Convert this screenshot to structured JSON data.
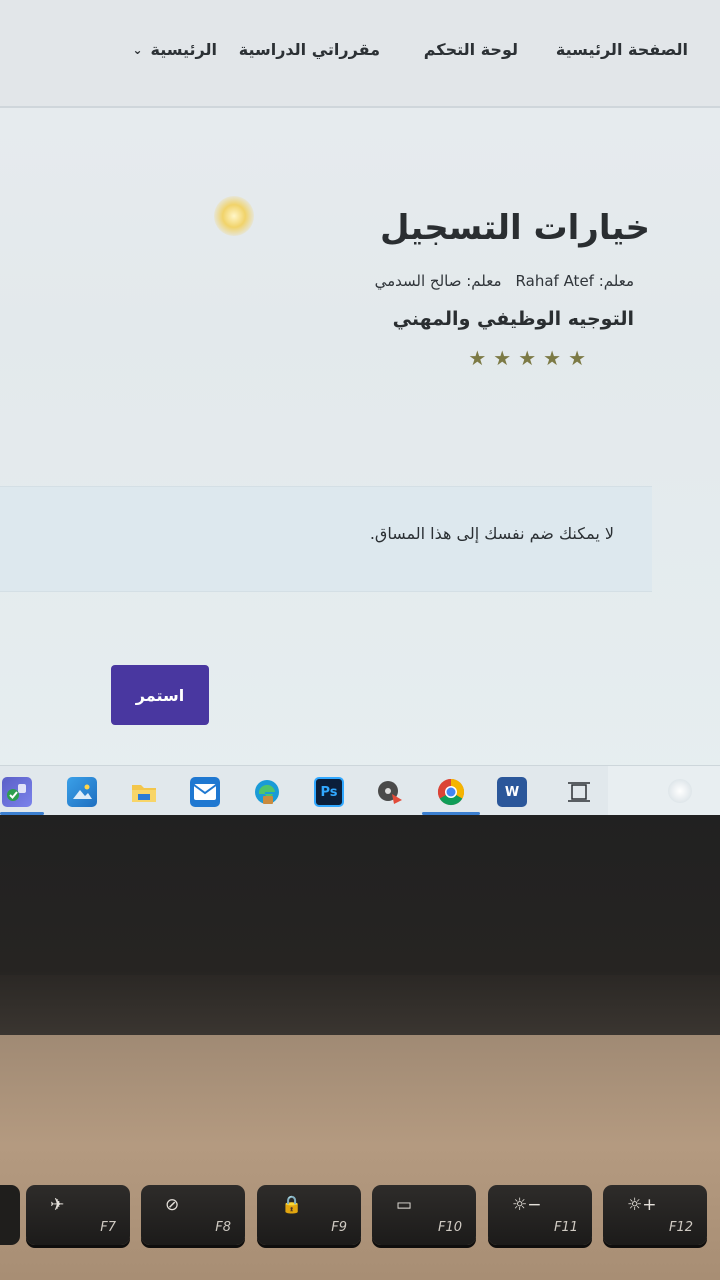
{
  "nav": {
    "home": "الصفحة الرئيسية",
    "dashboard": "لوحة التحكم",
    "my_courses": "مقرراتي الدراسية",
    "main": "الرئيسية",
    "main_chevron": "⌄"
  },
  "page": {
    "title": "خيارات التسجيل",
    "teacher1": "معلم: Rahaf Atef",
    "teacher2": "معلم: صالح السدمي",
    "course_name": "التوجيه الوظيفي والمهني",
    "rating": 5,
    "star_glyph": "★"
  },
  "notice": {
    "text": "لا يمكنك ضم نفسك إلى هذا المساق."
  },
  "buttons": {
    "continue": "استمر"
  },
  "taskbar": {
    "icons": [
      "teams-icon",
      "photos-icon",
      "file-explorer-icon",
      "mail-icon",
      "edge-icon",
      "photoshop-icon",
      "media-player-icon",
      "chrome-icon",
      "word-icon",
      "task-view-icon"
    ],
    "photoshop_label": "Ps",
    "word_label": "W"
  },
  "keyboard": {
    "keys": [
      {
        "label": "F7",
        "symbol": "✈"
      },
      {
        "label": "F8",
        "symbol": "⊘"
      },
      {
        "label": "F9",
        "symbol": "🔒"
      },
      {
        "label": "F10",
        "symbol": "▭"
      },
      {
        "label": "F11",
        "symbol": "☼−"
      },
      {
        "label": "F12",
        "symbol": "☼+"
      }
    ]
  },
  "colors": {
    "accent": "#4937a0",
    "star": "#7c7a45",
    "notice_bg": "#dde8ee"
  }
}
